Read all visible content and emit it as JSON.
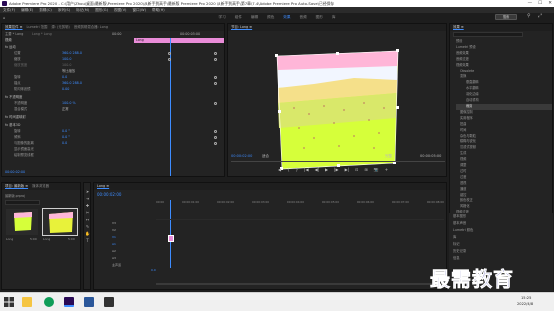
{
  "window": {
    "title": "Adobe Premiere Pro 2020 - C:\\用户\\Zhou\\桌面\\最新版\\Premiere Pro 2020\\从新手到高手\\最新版 Premiere Pro 2020 从新手到高手\\第7章\\7.4\\Adobe Premiere Pro Auto-Save\\已经保存",
    "controls": [
      "—",
      "☐",
      "✕"
    ]
  },
  "menu": [
    "文件(F)",
    "编辑(E)",
    "剪辑(C)",
    "序列(S)",
    "标记(M)",
    "图形(G)",
    "视图(V)",
    "窗口(W)",
    "帮助(H)"
  ],
  "workspaces": [
    "学习",
    "组件",
    "编辑",
    "颜色",
    "效果",
    "音频",
    "图形",
    "库"
  ],
  "workspace_active": "效果",
  "search_pill": "搜索",
  "effect_controls": {
    "tabs": [
      "效果控件 ≡",
      "Lumetri 范围",
      "源: (无剪辑)",
      "音频剪辑混合器: Long"
    ],
    "source_label": "主要 * Long",
    "seq_label": "Long * Long",
    "clip_label": "Long",
    "timecodes": [
      "00:00",
      "00:00:05:00"
    ],
    "video_header": "视频",
    "rows": [
      {
        "label": "fx 运动",
        "value": ""
      },
      {
        "label": "位置",
        "value": "360.0  288.0"
      },
      {
        "label": "缩放",
        "value": "100.0"
      },
      {
        "label": "缩放宽度",
        "value": "100.0"
      },
      {
        "label": "",
        "value": "等比缩放"
      },
      {
        "label": "旋转",
        "value": "0.0"
      },
      {
        "label": "锚点",
        "value": "360.0  288.0"
      },
      {
        "label": "防闪烁滤镜",
        "value": "0.00"
      },
      {
        "label": "fx 不透明度",
        "value": ""
      },
      {
        "label": "不透明度",
        "value": "100.0 %"
      },
      {
        "label": "混合模式",
        "value": "正常"
      },
      {
        "label": "fx 时间重映射",
        "value": ""
      },
      {
        "label": "fx 基本3D",
        "value": ""
      },
      {
        "label": "旋转",
        "value": "0.0 °"
      },
      {
        "label": "倾斜",
        "value": "0.0 °"
      },
      {
        "label": "与图像的距离",
        "value": "0.0"
      },
      {
        "label": "镜面高光",
        "value": "显示镜面高光"
      },
      {
        "label": "预览",
        "value": "绘制预览线框"
      }
    ],
    "bottom_timecode": "00:00:02:00"
  },
  "program": {
    "tabs": [
      "节目: Long ≡"
    ],
    "timecode_left": "00:00:02:00",
    "fit": "适合",
    "quality": "完整",
    "timecode_right": "00:00:05:00",
    "transport": [
      "◀",
      "{",
      "}",
      "|◀",
      "◀|",
      "▶",
      "|▶",
      "▶|",
      "⊡",
      "⊞",
      "📷",
      "+"
    ]
  },
  "project": {
    "tabs": [
      "项目: 最新版 ≡",
      "媒体浏览器"
    ],
    "name": "最新版.prproj",
    "clips": [
      {
        "name": "Long",
        "duration": "5:00"
      },
      {
        "name": "Long",
        "duration": "5:00"
      }
    ]
  },
  "timeline": {
    "tab": "Long ≡",
    "timecode": "00:00:02:00",
    "ruler": [
      "00:00",
      "00:00:01:00",
      "00:00:02:00",
      "00:00:03:00",
      "00:00:04:00",
      "00:00:05:00",
      "00:00:06:00",
      "00:00:07:00",
      "00:00:08:00"
    ],
    "video_tracks": [
      "V3",
      "V2",
      "V1"
    ],
    "audio_tracks": [
      "A1",
      "A2",
      "A3"
    ],
    "master": "主声道",
    "master_value": "0.0"
  },
  "effects_panel": {
    "tabs": [
      "效果 ≡"
    ],
    "tree": [
      "预设",
      "Lumetri 预设",
      "音频效果",
      "音频过渡",
      "视频效果",
      "Obsolete",
      "变换",
      "垂直翻转",
      "水平翻转",
      "羽化边缘",
      "自动重构",
      "裁剪",
      "图像控制",
      "实用程序",
      "扭曲",
      "时间",
      "杂色与颗粒",
      "模糊与锐化",
      "沉浸式视频",
      "生成",
      "视频",
      "调整",
      "过时",
      "过渡",
      "透视",
      "通道",
      "键控",
      "颜色校正",
      "风格化",
      "视频过渡"
    ],
    "selected": "裁剪",
    "bottom_items": [
      "基本图形",
      "基本声音",
      "Lumetri 颜色",
      "库",
      "标记",
      "历史记录",
      "信息"
    ]
  },
  "watermark": "最需教育",
  "taskbar": {
    "time": "15:25",
    "date": "2022/4/8"
  },
  "colors": {
    "accent": "#3d8cff",
    "clip_pink": "#e98cd8",
    "keyframe_yellow": "#e7e41e"
  }
}
